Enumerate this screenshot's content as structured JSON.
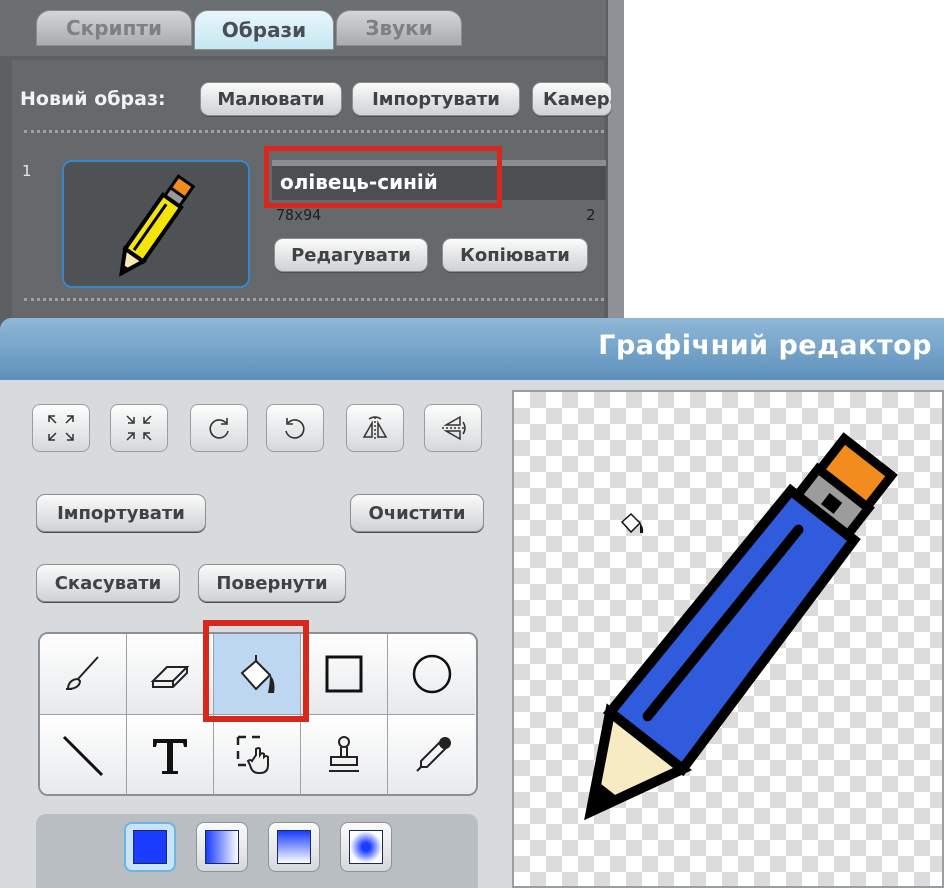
{
  "tabs": {
    "scripts": "Скрипти",
    "costumes": "Образи",
    "sounds": "Звуки"
  },
  "new_costume": {
    "label": "Новий образ:",
    "paint": "Малювати",
    "import": "Імпортувати",
    "camera": "Камера"
  },
  "costume": {
    "index": "1",
    "name": "олівець-синій",
    "size": "78x94",
    "kb": "2",
    "edit": "Редагувати",
    "copy": "Копіювати"
  },
  "paint_editor": {
    "title": "Графічний редактор",
    "import": "Імпортувати",
    "clear": "Очистити",
    "undo": "Скасувати",
    "redo": "Повернути",
    "icons": [
      "grow-icon",
      "shrink-icon",
      "rotate-left-icon",
      "rotate-right-icon",
      "flip-horizontal-icon",
      "flip-vertical-icon"
    ],
    "tools": [
      "paintbrush-icon",
      "eraser-icon",
      "fill-bucket-icon",
      "rectangle-icon",
      "ellipse-icon",
      "line-icon",
      "text-icon",
      "select-icon",
      "stamp-icon",
      "eyedropper-icon"
    ],
    "selected_tool": "fill-bucket-icon",
    "fill_modes": [
      "solid",
      "horizontal-gradient",
      "vertical-gradient",
      "radial-gradient"
    ],
    "selected_fill": "solid",
    "colors": {
      "accent": "#1a3cff",
      "highlight": "#d8271c",
      "pencil_body": "#2f5bdc",
      "pencil_tip_eraser": "#f28c1e"
    }
  }
}
